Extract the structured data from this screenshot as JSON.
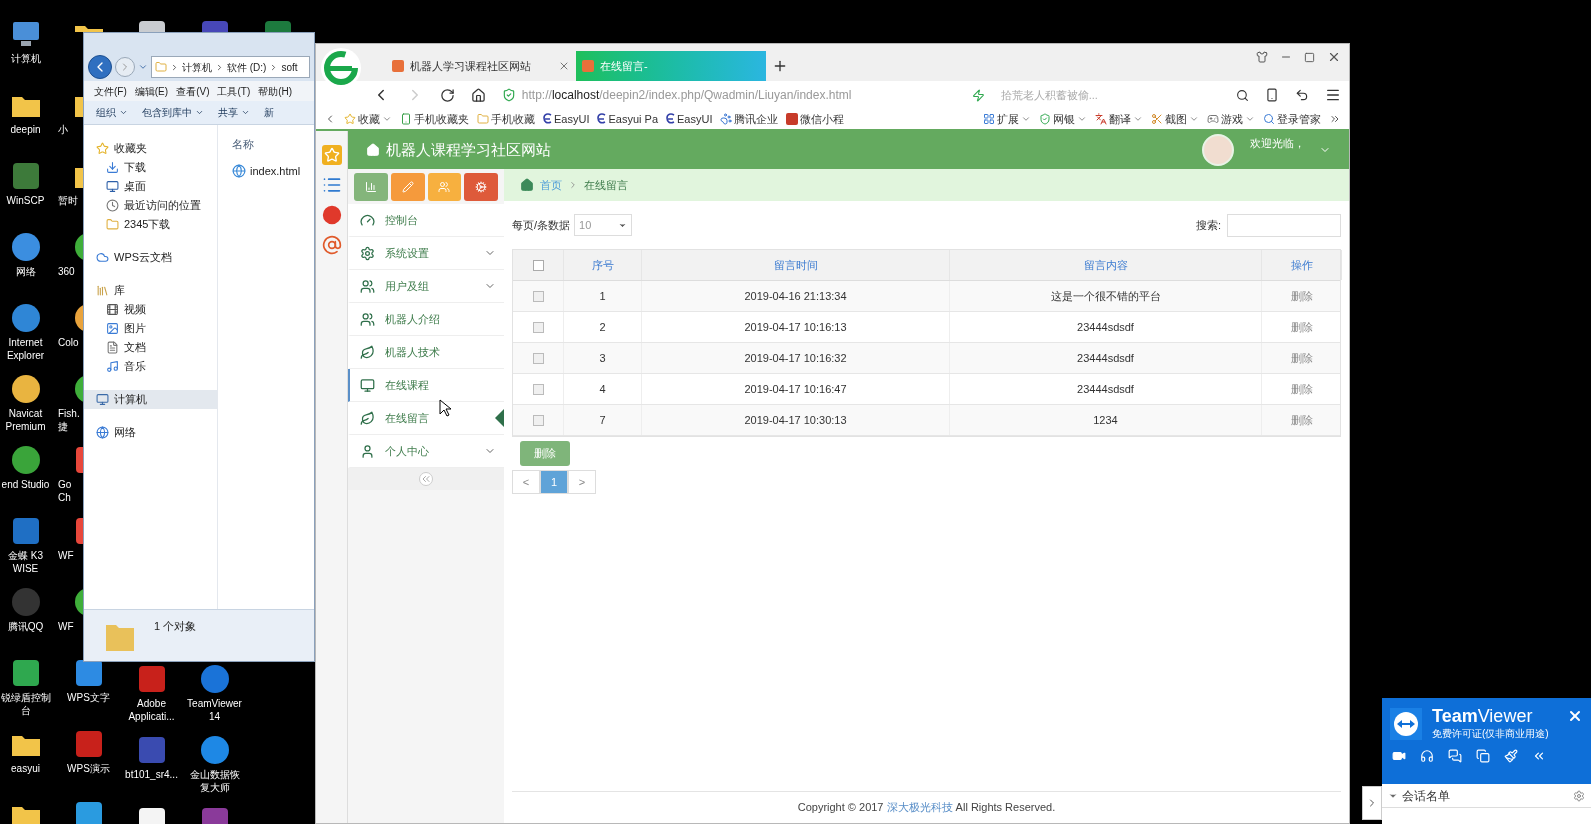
{
  "desktop": {
    "columns": [
      {
        "icons": [
          {
            "kind": "computer",
            "label": "计算机"
          },
          {
            "kind": "folder",
            "label": "deepin"
          },
          {
            "kind": "winscp",
            "label": "WinSCP"
          },
          {
            "kind": "network",
            "label": "网络"
          },
          {
            "kind": "ie",
            "label": "Internet Explorer"
          },
          {
            "kind": "navicat",
            "label": "Navicat Premium"
          },
          {
            "kind": "zend",
            "label": "end Studio"
          },
          {
            "kind": "k3",
            "label": "金蝶 K3 WISE"
          },
          {
            "kind": "qq",
            "label": "腾讯QQ"
          },
          {
            "kind": "shield",
            "label": "锐绿盾控制台"
          },
          {
            "kind": "folder",
            "label": "easyui"
          },
          {
            "kind": "folder"
          }
        ]
      },
      {
        "icons": [
          {
            "kind": "folder",
            "cut": true
          },
          {
            "kind": "folder",
            "label": "小",
            "cut": true
          },
          {
            "kind": "folder",
            "label": "暂时",
            "cut": true
          },
          {
            "kind": "green",
            "label": "360",
            "cut": true
          },
          {
            "kind": "color",
            "label": "Colo",
            "cut": true
          },
          {
            "kind": "green",
            "label": "Fish.\n捷",
            "cut": true
          },
          {
            "kind": "red",
            "label": "Go\nCh",
            "cut": true
          },
          {
            "kind": "red",
            "label": "WF",
            "cut": true
          },
          {
            "kind": "green",
            "label": "WF",
            "cut": true
          },
          {
            "kind": "wps",
            "label": "WPS文字",
            "cut": false
          },
          {
            "kind": "adobe",
            "label": "WPS演示",
            "cut": false
          },
          {
            "kind": "wifi"
          }
        ]
      },
      {
        "icons": [
          {
            "kind": "recycle",
            "cut": true
          }
        ],
        "bottom": [
          {
            "kind": "adobe",
            "label": "Adobe Applicati..."
          },
          {
            "kind": "bt",
            "label": "bt101_sr4..."
          },
          {
            "kind": "file"
          }
        ]
      },
      {
        "icons": [
          {
            "kind": "barcode",
            "cut": true
          }
        ],
        "bottom": [
          {
            "kind": "teamviewer",
            "label": "TeamViewer 14"
          },
          {
            "kind": "recovery",
            "label": "金山数据恢复大师"
          },
          {
            "kind": "winrar"
          }
        ]
      },
      {
        "icons": [
          {
            "kind": "excel",
            "cut": true
          }
        ]
      }
    ]
  },
  "explorer": {
    "path": [
      "计算机",
      "软件 (D:)",
      "soft"
    ],
    "menu": [
      "文件(F)",
      "编辑(E)",
      "查看(V)",
      "工具(T)",
      "帮助(H)"
    ],
    "toolbar": [
      {
        "label": "组织",
        "dropdown": true
      },
      {
        "label": "包含到库中",
        "dropdown": true
      },
      {
        "label": "共享",
        "dropdown": true
      },
      {
        "label": "新",
        "dropdown": false
      }
    ],
    "nav": [
      {
        "label": "收藏夹",
        "kind": "star",
        "selected": false,
        "children": [
          {
            "label": "下载",
            "kind": "download",
            "selected": false
          },
          {
            "label": "桌面",
            "kind": "desktop",
            "selected": false
          },
          {
            "label": "最近访问的位置",
            "kind": "recent",
            "selected": false
          },
          {
            "label": "2345下载",
            "kind": "folder",
            "selected": false
          }
        ]
      },
      {
        "label": "WPS云文档",
        "kind": "cloud",
        "selected": false
      },
      {
        "label": "库",
        "kind": "library",
        "selected": false,
        "children": [
          {
            "label": "视频",
            "kind": "video",
            "selected": false
          },
          {
            "label": "图片",
            "kind": "image",
            "selected": false
          },
          {
            "label": "文档",
            "kind": "doc",
            "selected": false
          },
          {
            "label": "音乐",
            "kind": "music",
            "selected": false
          }
        ]
      },
      {
        "label": "计算机",
        "kind": "computer",
        "selected": true
      },
      {
        "label": "网络",
        "kind": "network",
        "selected": false
      }
    ],
    "column_header": "名称",
    "files": [
      "index.html"
    ],
    "status": "1 个对象"
  },
  "browser": {
    "tabs": [
      {
        "title": "机器人学习课程社区网站",
        "selected": false
      },
      {
        "title": "在线留言-",
        "selected": true
      }
    ],
    "url": {
      "scheme": "http://",
      "host": "localhost",
      "path": "/deepin2/index.php/Qwadmin/Liuyan/index.html"
    },
    "search": {
      "placeholder": "拾荒老人积蓄被偷..."
    },
    "bookmarks_left": [
      {
        "label": "收藏",
        "kind": "star",
        "dropdown": true
      },
      {
        "label": "手机收藏夹",
        "kind": "phone",
        "dropdown": false
      },
      {
        "label": "手机收藏",
        "kind": "folder",
        "dropdown": false
      },
      {
        "label": "EasyUI",
        "kind": "e",
        "dropdown": false
      },
      {
        "label": "Easyui Pa",
        "kind": "e",
        "dropdown": false
      },
      {
        "label": "EasyUI",
        "kind": "e",
        "dropdown": false
      },
      {
        "label": "腾讯企业",
        "kind": "paw",
        "dropdown": false
      },
      {
        "label": "微信小程",
        "kind": "w",
        "dropdown": false
      }
    ],
    "bookmarks_right": [
      {
        "label": "扩展",
        "kind": "grid",
        "dropdown": true
      },
      {
        "label": "网银",
        "kind": "shield",
        "dropdown": true
      },
      {
        "label": "翻译",
        "kind": "translate",
        "dropdown": true
      },
      {
        "label": "截图",
        "kind": "scissors",
        "dropdown": true
      },
      {
        "label": "游戏",
        "kind": "game",
        "dropdown": true
      },
      {
        "label": "登录管家",
        "kind": "search",
        "dropdown": false
      }
    ]
  },
  "site": {
    "title": "机器人课程学习社区网站",
    "welcome": "欢迎光临，",
    "quick_buttons": [
      {
        "kind": "chart",
        "color": "#84b57b"
      },
      {
        "kind": "pencil",
        "color": "#f59a3c"
      },
      {
        "kind": "users",
        "color": "#f7b03f"
      },
      {
        "kind": "cogs",
        "color": "#de5a3a"
      }
    ],
    "menu": [
      {
        "label": "控制台",
        "kind": "dashboard",
        "submenu": false,
        "selected": false,
        "hover": false
      },
      {
        "label": "系统设置",
        "kind": "gear",
        "submenu": true,
        "selected": false,
        "hover": false
      },
      {
        "label": "用户及组",
        "kind": "users",
        "submenu": true,
        "selected": false,
        "hover": false
      },
      {
        "label": "机器人介绍",
        "kind": "users",
        "submenu": false,
        "selected": false,
        "hover": false
      },
      {
        "label": "机器人技术",
        "kind": "leaf",
        "submenu": false,
        "selected": false,
        "hover": false
      },
      {
        "label": "在线课程",
        "kind": "monitor",
        "submenu": false,
        "selected": false,
        "hover": true
      },
      {
        "label": "在线留言",
        "kind": "leaf",
        "submenu": false,
        "selected": true,
        "hover": false
      },
      {
        "label": "个人中心",
        "kind": "user",
        "submenu": true,
        "selected": false,
        "hover": false
      }
    ],
    "breadcrumb": [
      "首页",
      "在线留言"
    ],
    "page_size": {
      "label": "每页/条数据",
      "value": "10"
    },
    "search_label": "搜索:",
    "table": {
      "header_checked": false,
      "columns": [
        "序号",
        "留言时间",
        "留言内容",
        "操作"
      ],
      "rows": [
        {
          "checked": false,
          "cells": [
            "1",
            "2019-04-16 21:13:34",
            "这是一个很不错的平台"
          ],
          "action": "删除"
        },
        {
          "checked": false,
          "cells": [
            "2",
            "2019-04-17 10:16:13",
            "23444sdsdf"
          ],
          "action": "删除"
        },
        {
          "checked": false,
          "cells": [
            "3",
            "2019-04-17 10:16:32",
            "23444sdsdf"
          ],
          "action": "删除"
        },
        {
          "checked": false,
          "cells": [
            "4",
            "2019-04-17 10:16:47",
            "23444sdsdf"
          ],
          "action": "删除"
        },
        {
          "checked": false,
          "cells": [
            "7",
            "2019-04-17 10:30:13",
            "1234"
          ],
          "action": "删除"
        }
      ]
    },
    "delete_button": "删除",
    "pages": [
      {
        "label": "<",
        "selected": false
      },
      {
        "label": "1",
        "selected": true
      },
      {
        "label": ">",
        "selected": false
      }
    ],
    "footer": {
      "before": "Copyright © 2017 ",
      "link": "深大极光科技",
      "after": " All Rights Reserved."
    }
  },
  "teamviewer": {
    "title": "**Team**Viewer",
    "subtitle": "免费许可证(仅非商业用途)",
    "section": "会话名单"
  }
}
